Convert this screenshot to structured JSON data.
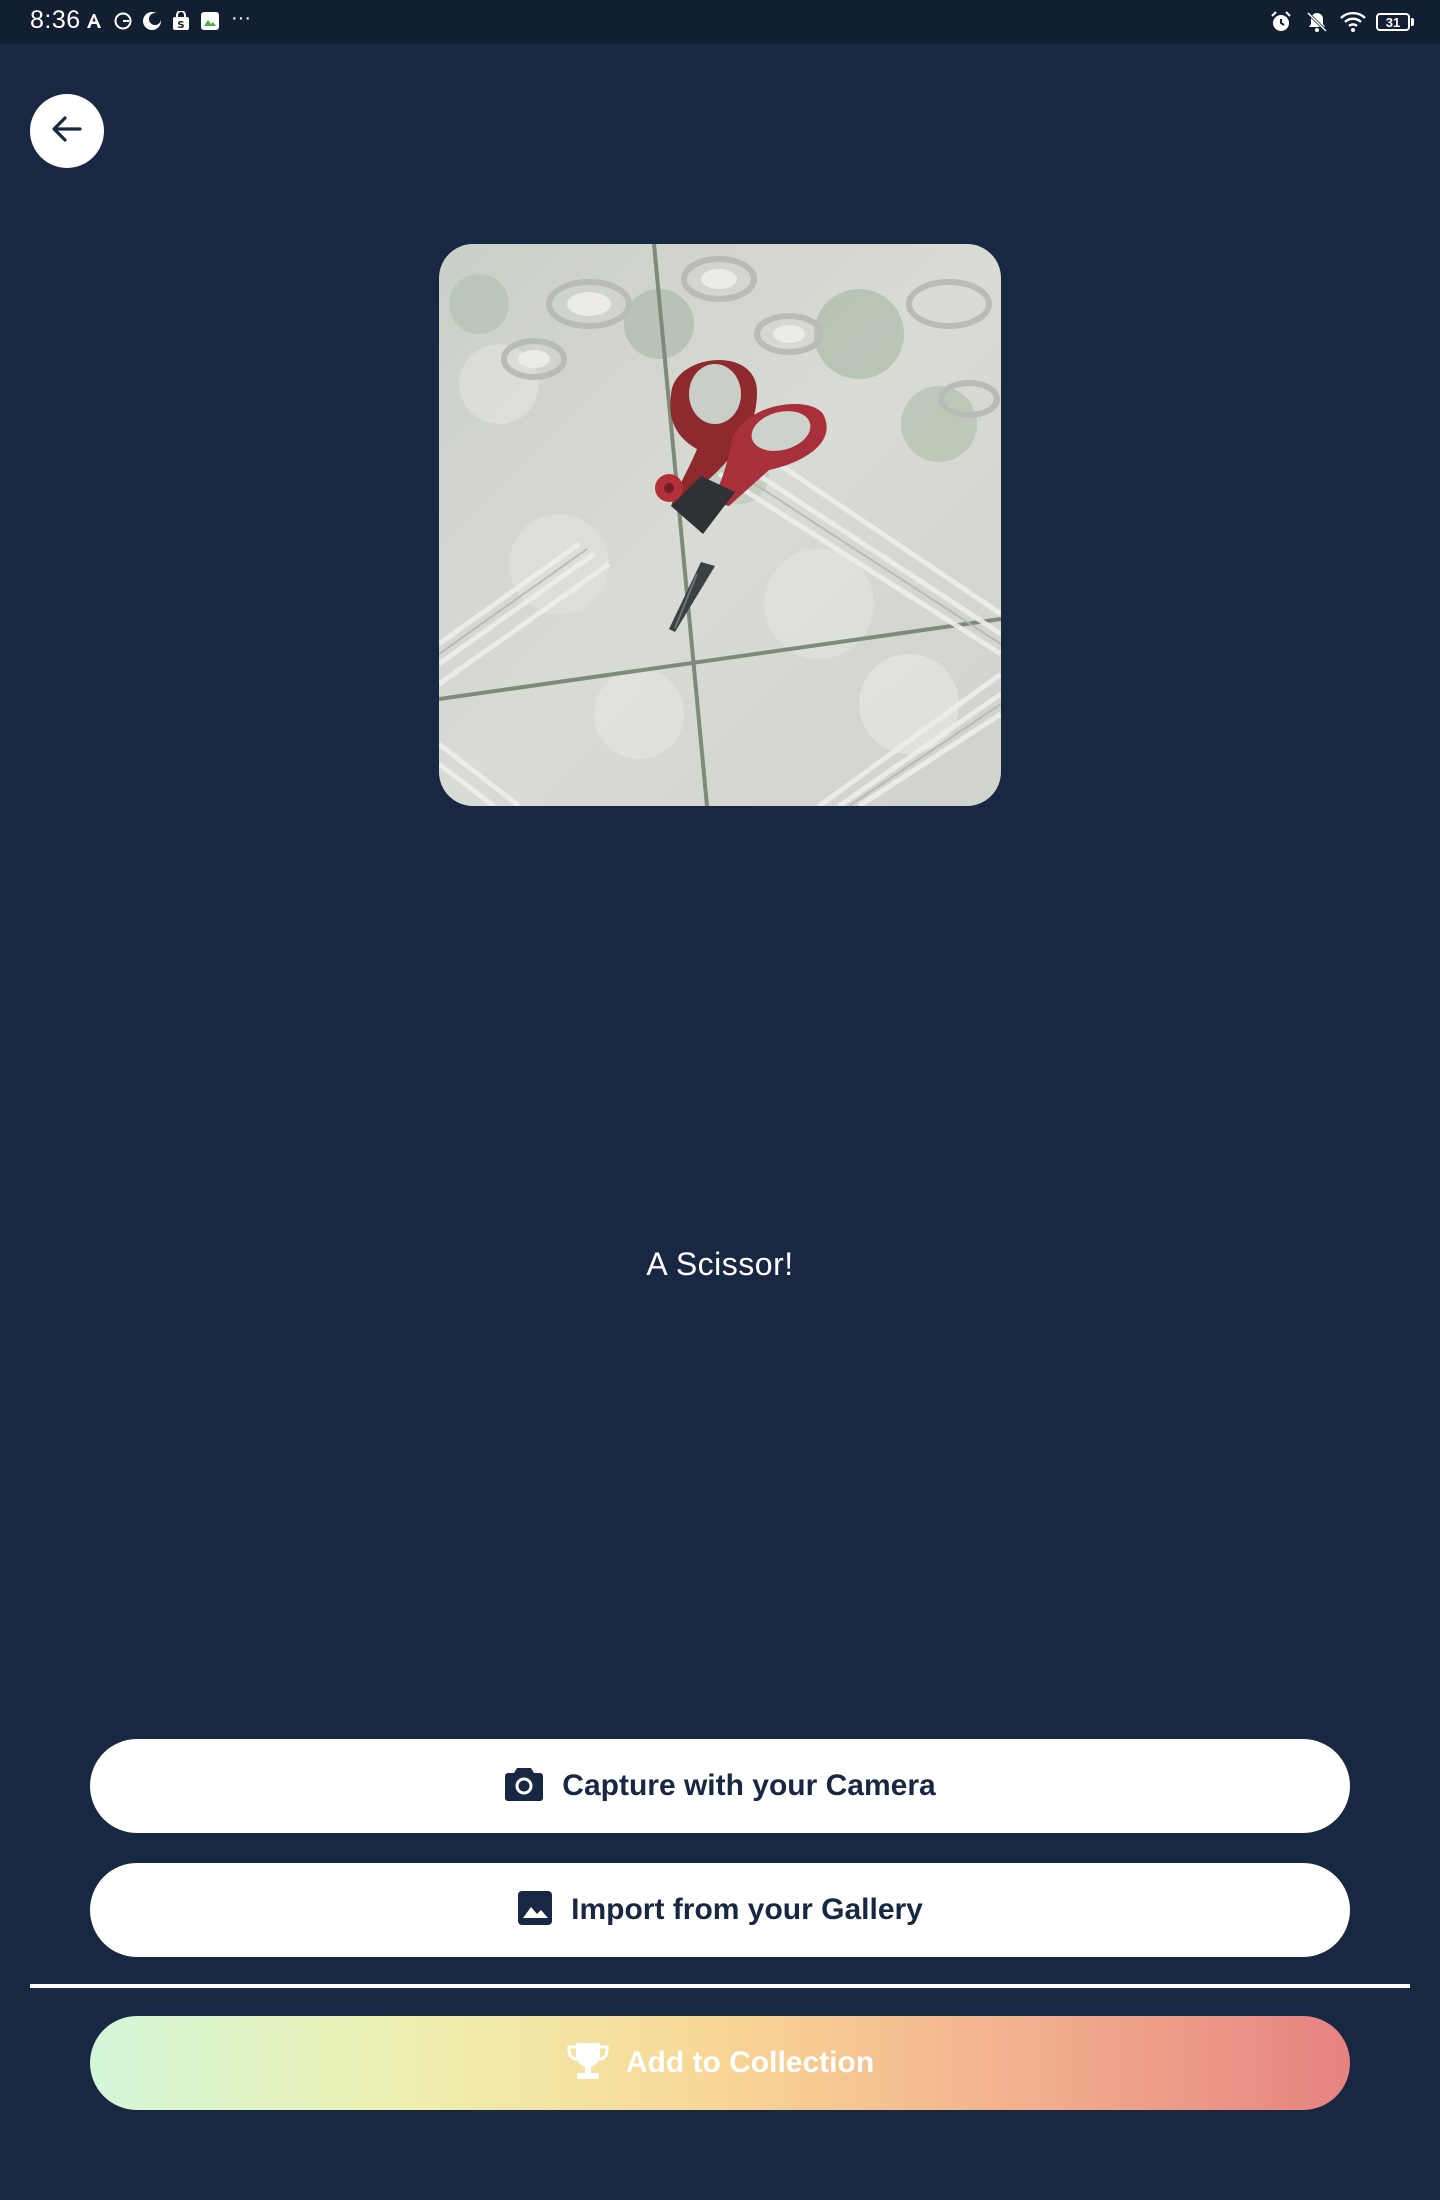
{
  "status_bar": {
    "time": "8:36",
    "left_icons": [
      "font-a-icon",
      "grammarly-icon",
      "moon-app-icon",
      "shopping-bag-icon",
      "photo-app-icon"
    ],
    "more": "···",
    "right_icons": [
      "alarm-icon",
      "bell-off-icon",
      "wifi-icon",
      "battery-icon"
    ],
    "battery_level": "31"
  },
  "back_button": {
    "icon": "arrow-left-icon"
  },
  "preview": {
    "icon": "scissors-photo"
  },
  "result": {
    "text": "A Scissor!"
  },
  "buttons": {
    "camera": {
      "label": "Capture with your Camera",
      "icon": "camera-icon"
    },
    "gallery": {
      "label": "Import from your Gallery",
      "icon": "image-icon"
    },
    "collection": {
      "label": "Add to Collection",
      "icon": "trophy-icon"
    }
  },
  "colors": {
    "background": "#182742",
    "status_bar": "#121f33",
    "button_bg": "#ffffff",
    "button_text": "#182742",
    "gradient": [
      "#d3f7d9",
      "#eef0b0",
      "#f8d695",
      "#f2ae8e",
      "#e68280"
    ]
  }
}
